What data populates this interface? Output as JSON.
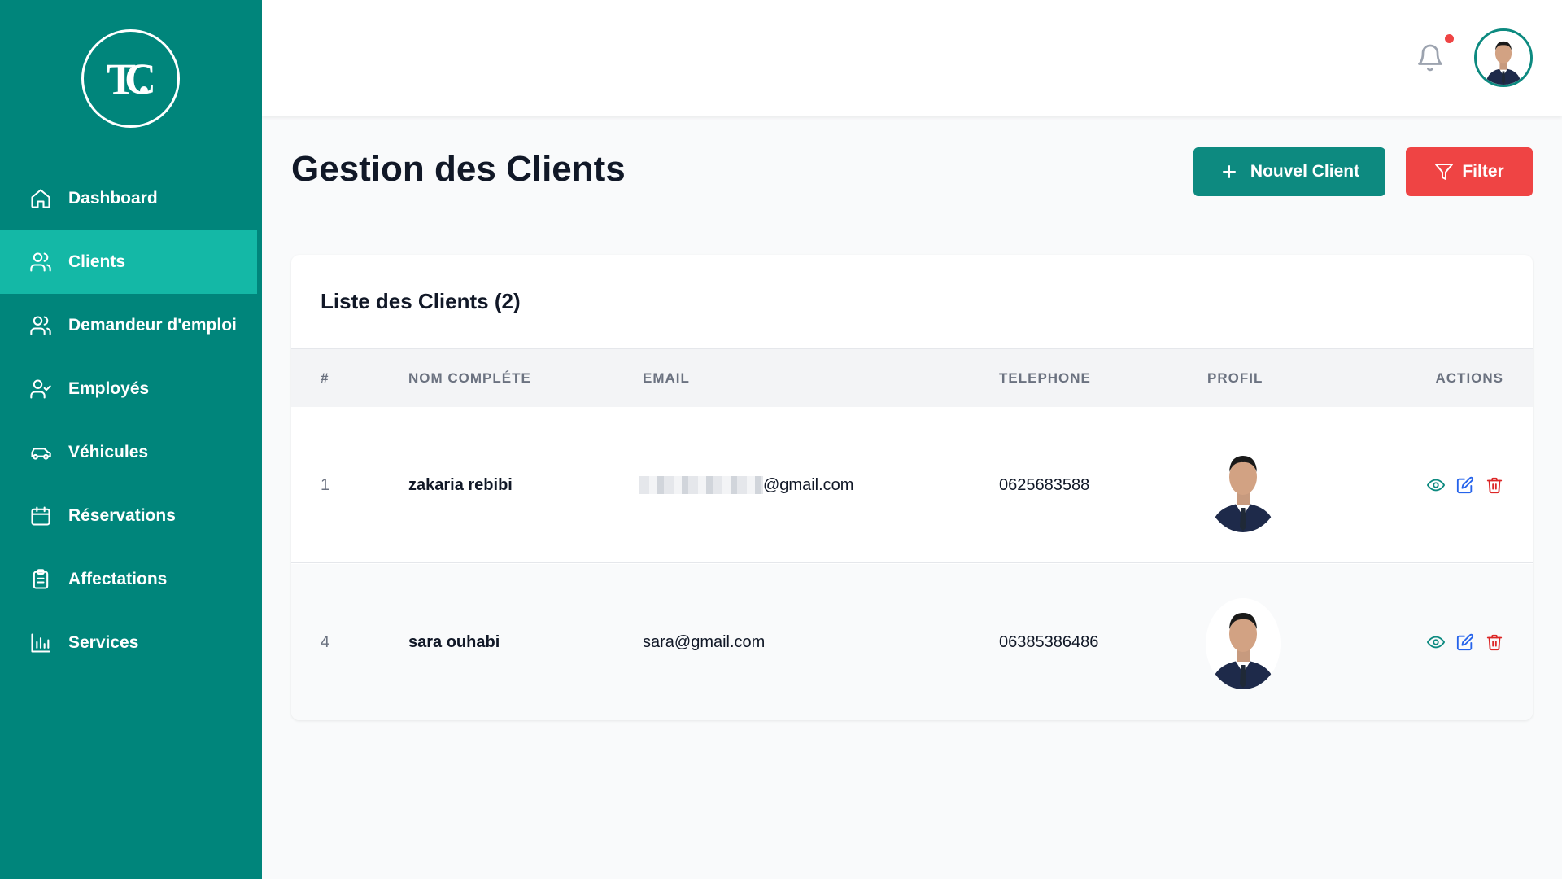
{
  "brand": {
    "logo_text": "TC"
  },
  "sidebar": {
    "items": [
      {
        "label": "Dashboard",
        "icon": "home-icon"
      },
      {
        "label": "Clients",
        "icon": "users-icon",
        "active": true
      },
      {
        "label": "Demandeur d'emploi",
        "icon": "users-icon"
      },
      {
        "label": "Employés",
        "icon": "user-check-icon"
      },
      {
        "label": "Véhicules",
        "icon": "car-icon"
      },
      {
        "label": "Réservations",
        "icon": "calendar-icon"
      },
      {
        "label": "Affectations",
        "icon": "clipboard-icon"
      },
      {
        "label": "Services",
        "icon": "bar-chart-icon"
      }
    ]
  },
  "header": {
    "notification_icon": "bell-icon",
    "has_notification": true
  },
  "main": {
    "title": "Gestion des Clients",
    "new_button": "Nouvel Client",
    "filter_button": "Filter"
  },
  "table": {
    "title": "Liste des Clients (2)",
    "columns": [
      "#",
      "NOM COMPLÉTE",
      "EMAIL",
      "TELEPHONE",
      "PROFIL",
      "ACTIONS"
    ],
    "rows": [
      {
        "id": "1",
        "name": "zakaria rebibi",
        "email": "@gmail.com",
        "phone": "0625683588"
      },
      {
        "id": "4",
        "name": "sara ouhabi",
        "email": "sara@gmail.com",
        "phone": "06385386486"
      }
    ]
  },
  "colors": {
    "sidebar": "#00857b",
    "sidebar_active": "#14b8a6",
    "primary": "#0d8a80",
    "danger": "#ef4444"
  }
}
